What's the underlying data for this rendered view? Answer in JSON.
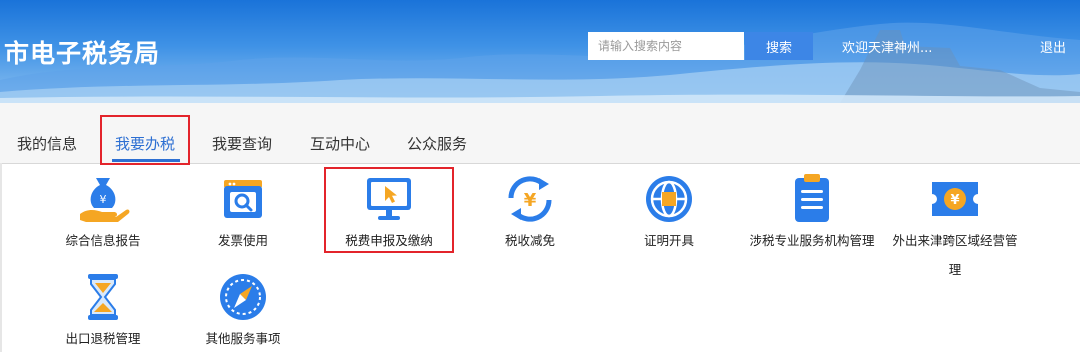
{
  "header": {
    "site_title": "市电子税务局",
    "search_placeholder": "请输入搜索内容",
    "search_button": "搜索",
    "welcome": "欢迎天津神州...",
    "logout": "退出"
  },
  "tabs": [
    {
      "label": "我的信息",
      "active": false
    },
    {
      "label": "我要办税",
      "active": true
    },
    {
      "label": "我要查询",
      "active": false
    },
    {
      "label": "互动中心",
      "active": false
    },
    {
      "label": "公众服务",
      "active": false
    }
  ],
  "services": [
    {
      "label": "综合信息报告",
      "icon": "money-bag-hand-icon"
    },
    {
      "label": "发票使用",
      "icon": "invoice-search-icon"
    },
    {
      "label": "税费申报及缴纳",
      "icon": "monitor-cursor-icon"
    },
    {
      "label": "税收减免",
      "icon": "yuan-refresh-icon"
    },
    {
      "label": "证明开具",
      "icon": "globe-certificate-icon"
    },
    {
      "label": "涉税专业服务机构管理",
      "icon": "clipboard-icon"
    },
    {
      "label": "外出来津跨区域经营管",
      "label_line2": "理",
      "icon": "yuan-ticket-icon"
    },
    {
      "label": "出口退税管理",
      "icon": "hourglass-icon"
    },
    {
      "label": "其他服务事项",
      "icon": "compass-icon"
    }
  ],
  "colors": {
    "accent": "#2d6fd2",
    "highlight_box": "#e3242b",
    "icon_blue": "#2b7de9",
    "icon_orange": "#f5a623"
  }
}
